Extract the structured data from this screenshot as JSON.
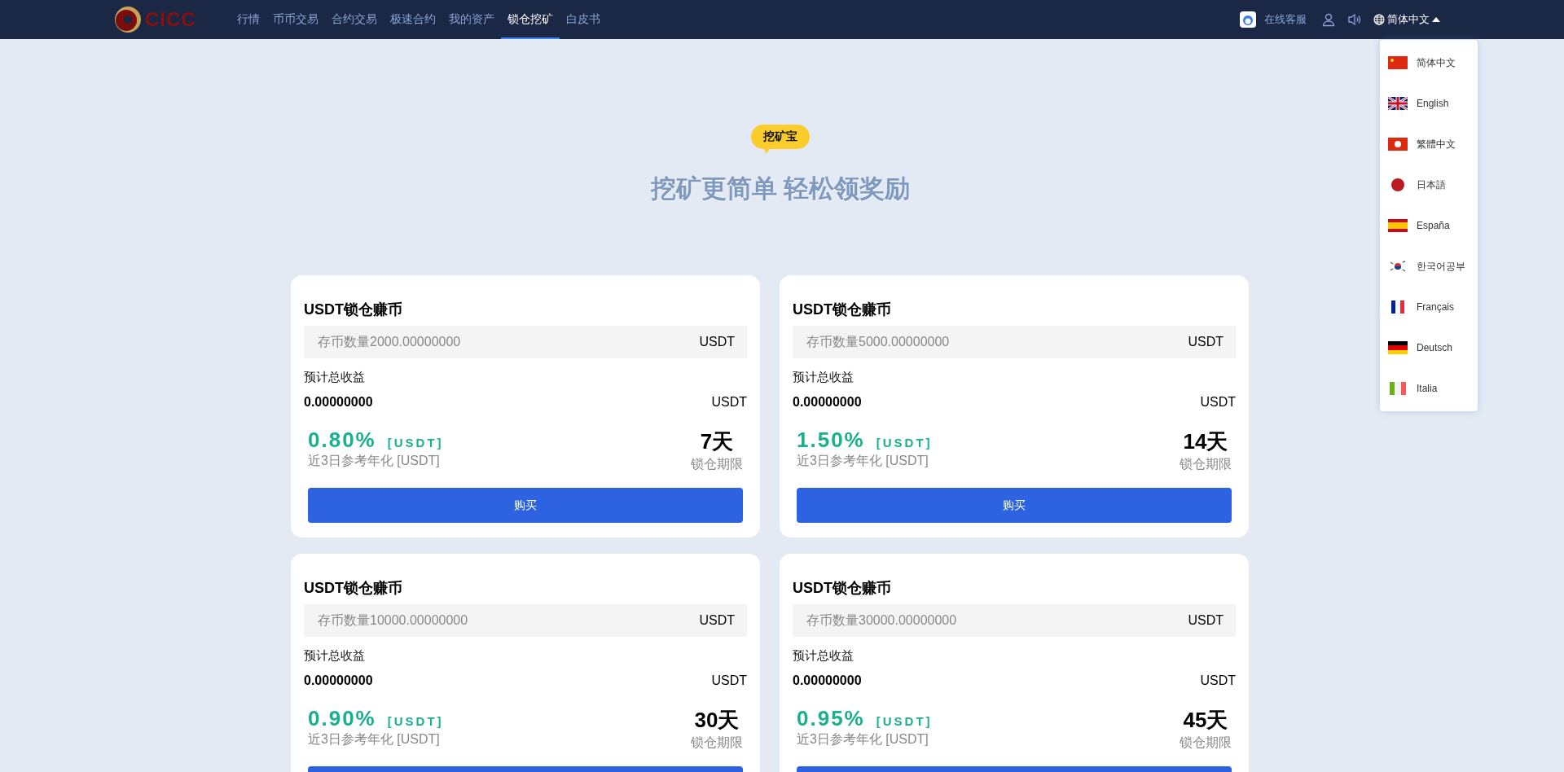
{
  "header": {
    "logo_text": "CICC",
    "nav": [
      {
        "label": "行情",
        "selected": false
      },
      {
        "label": "币币交易",
        "selected": false
      },
      {
        "label": "合约交易",
        "selected": false
      },
      {
        "label": "极速合约",
        "selected": false
      },
      {
        "label": "我的资产",
        "selected": false
      },
      {
        "label": "锁仓挖矿",
        "selected": true
      },
      {
        "label": "白皮书",
        "selected": false
      }
    ],
    "support": "在线客服",
    "language": "简体中文"
  },
  "language_menu": [
    "简体中文",
    "English",
    "繁體中文",
    "日本語",
    "España",
    "한국어공부",
    "Français",
    "Deutsch",
    "Italia"
  ],
  "hero": {
    "badge": "挖矿宝",
    "title": "挖矿更简单 轻松领奖励"
  },
  "cards": [
    {
      "title": "USDT锁仓赚币",
      "amount_placeholder": "存币数量2000.00000000",
      "amount_unit": "USDT",
      "estimate_label": "预计总收益",
      "estimate_value": "0.00000000",
      "estimate_unit": "USDT",
      "rate": "0.80%",
      "rate_unit": "[USDT]",
      "rate_label": "近3日参考年化 [USDT]",
      "term": "7天",
      "term_label": "锁仓期限",
      "button": "购买"
    },
    {
      "title": "USDT锁仓赚币",
      "amount_placeholder": "存币数量5000.00000000",
      "amount_unit": "USDT",
      "estimate_label": "预计总收益",
      "estimate_value": "0.00000000",
      "estimate_unit": "USDT",
      "rate": "1.50%",
      "rate_unit": "[USDT]",
      "rate_label": "近3日参考年化 [USDT]",
      "term": "14天",
      "term_label": "锁仓期限",
      "button": "购买"
    },
    {
      "title": "USDT锁仓赚币",
      "amount_placeholder": "存币数量10000.00000000",
      "amount_unit": "USDT",
      "estimate_label": "预计总收益",
      "estimate_value": "0.00000000",
      "estimate_unit": "USDT",
      "rate": "0.90%",
      "rate_unit": "[USDT]",
      "rate_label": "近3日参考年化 [USDT]",
      "term": "30天",
      "term_label": "锁仓期限"
    },
    {
      "title": "USDT锁仓赚币",
      "amount_placeholder": "存币数量30000.00000000",
      "amount_unit": "USDT",
      "estimate_label": "预计总收益",
      "estimate_value": "0.00000000",
      "estimate_unit": "USDT",
      "rate": "0.95%",
      "rate_unit": "[USDT]",
      "rate_label": "近3日参考年化 [USDT]",
      "term": "45天",
      "term_label": "锁仓期限"
    }
  ]
}
